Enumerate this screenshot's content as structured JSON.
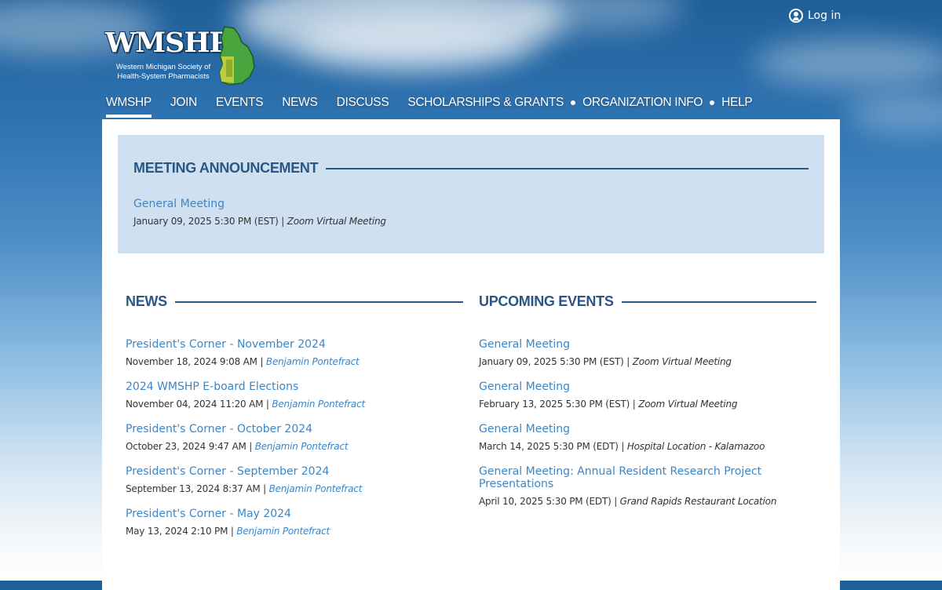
{
  "header": {
    "login_label": "Log in",
    "logo": {
      "wordmark": "WMSHP",
      "subtitle_line1": "Western Michigan Society of",
      "subtitle_line2": "Health-System Pharmacists"
    }
  },
  "nav": {
    "items": [
      {
        "label": "WMSHP"
      },
      {
        "label": "JOIN"
      },
      {
        "label": "EVENTS"
      },
      {
        "label": "NEWS"
      },
      {
        "label": "DISCUSS"
      },
      {
        "label": "SCHOLARSHIPS & GRANTS"
      },
      {
        "label": "ORGANIZATION INFO"
      },
      {
        "label": "HELP"
      }
    ]
  },
  "announcement": {
    "title": "MEETING ANNOUNCEMENT",
    "item": {
      "title": "General Meeting",
      "datetime": "January 09, 2025 5:30 PM (EST)",
      "separator": " | ",
      "location": "Zoom Virtual Meeting"
    }
  },
  "news": {
    "title": "NEWS",
    "items": [
      {
        "title": "President's Corner - November 2024",
        "datetime": "November 18, 2024 9:08 AM",
        "author": "Benjamin Pontefract"
      },
      {
        "title": "2024 WMSHP E-board Elections",
        "datetime": "November 04, 2024 11:20 AM",
        "author": "Benjamin Pontefract"
      },
      {
        "title": "President's Corner - October 2024",
        "datetime": "October 23, 2024 9:47 AM",
        "author": "Benjamin Pontefract"
      },
      {
        "title": "President's Corner - September 2024",
        "datetime": "September 13, 2024 8:37 AM",
        "author": "Benjamin Pontefract"
      },
      {
        "title": "President's Corner - May 2024",
        "datetime": "May 13, 2024 2:10 PM",
        "author": "Benjamin Pontefract"
      }
    ]
  },
  "events": {
    "title": "UPCOMING EVENTS",
    "items": [
      {
        "title": "General Meeting",
        "datetime": "January 09, 2025 5:30 PM (EST)",
        "location": "Zoom Virtual Meeting"
      },
      {
        "title": "General Meeting",
        "datetime": "February 13, 2025 5:30 PM (EST)",
        "location": "Zoom Virtual Meeting"
      },
      {
        "title": "General Meeting",
        "datetime": "March 14, 2025 5:30 PM (EDT)",
        "location": "Hospital Location - Kalamazoo"
      },
      {
        "title": "General Meeting: Annual Resident Research Project Presentations",
        "datetime": "April 10, 2025 5:30 PM (EDT)",
        "location": "Grand Rapids Restaurant Location"
      }
    ]
  },
  "separator": " | ",
  "colors": {
    "heading": "#2a5684",
    "link": "#3a86c8",
    "announce_bg": "#cfe1f0"
  }
}
